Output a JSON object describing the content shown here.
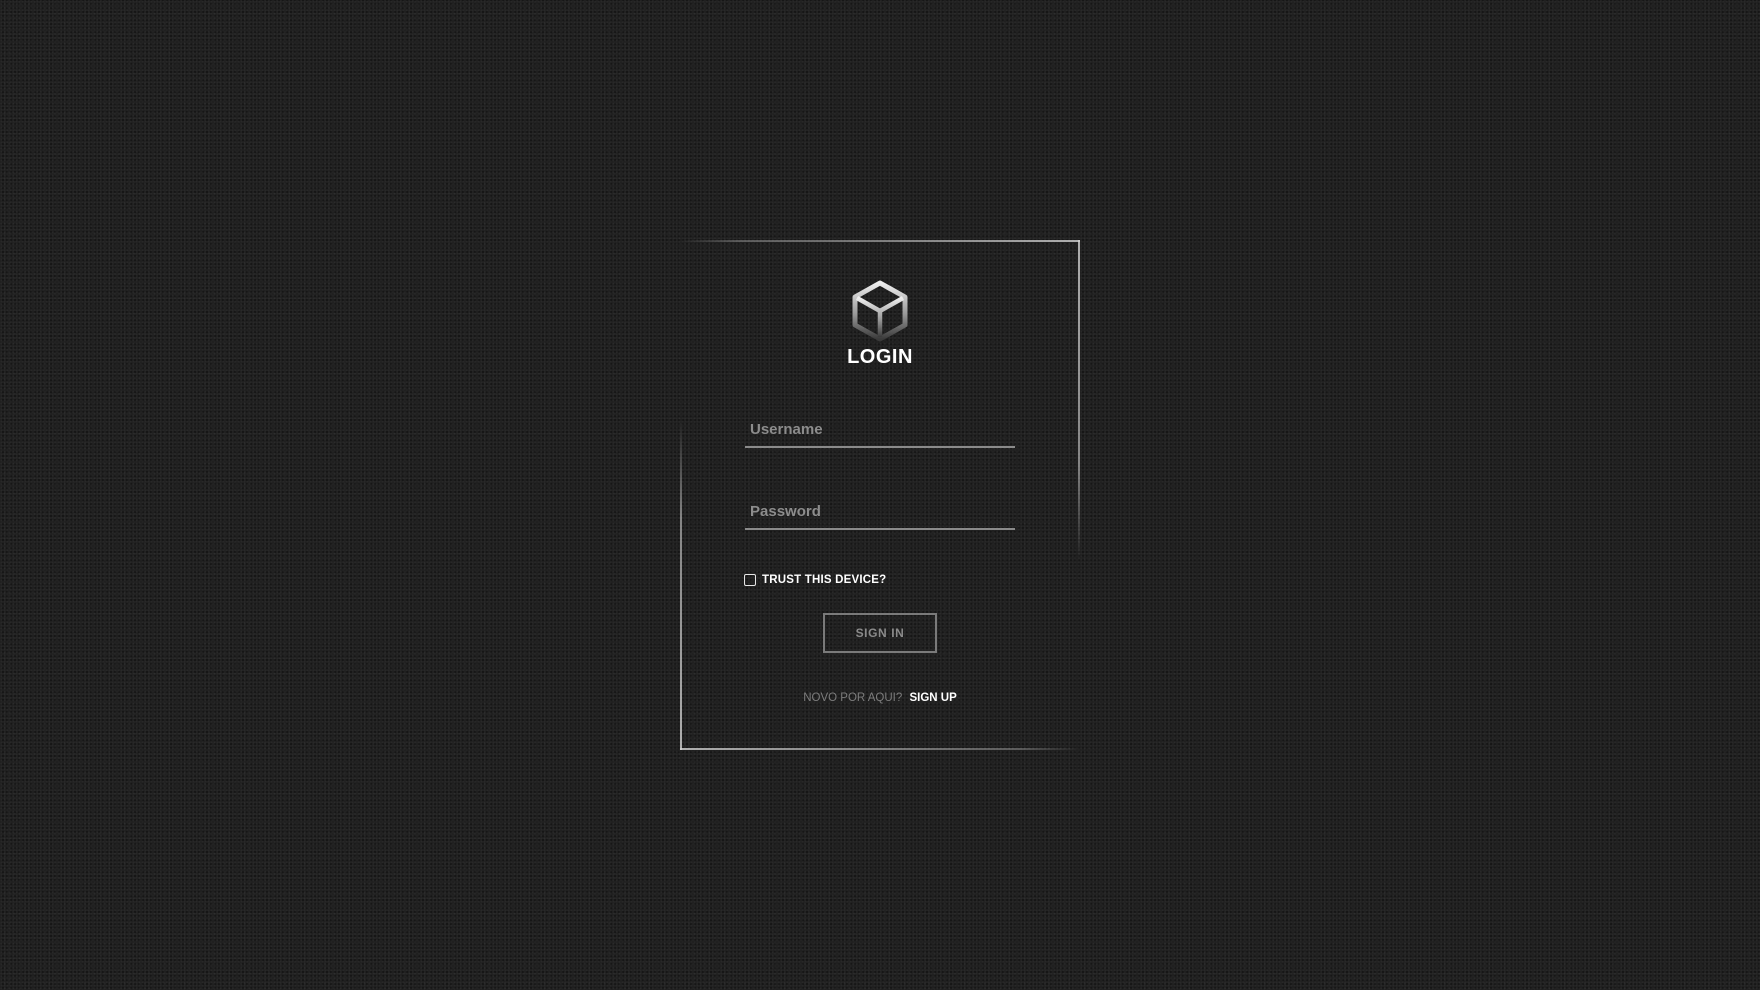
{
  "login": {
    "title": "LOGIN",
    "logo_icon": "cube-icon",
    "username": {
      "placeholder": "Username",
      "value": ""
    },
    "password": {
      "placeholder": "Password",
      "value": ""
    },
    "trust_device": {
      "label": "TRUST THIS DEVICE?",
      "checked": false
    },
    "signin_label": "SIGN IN",
    "signup_prompt": "NOVO POR AQUI?",
    "signup_link": "SIGN UP"
  },
  "colors": {
    "background": "#1e1e1e",
    "text_primary": "#ffffff",
    "text_muted": "#7c7c7c",
    "border": "#d2d2d2"
  }
}
